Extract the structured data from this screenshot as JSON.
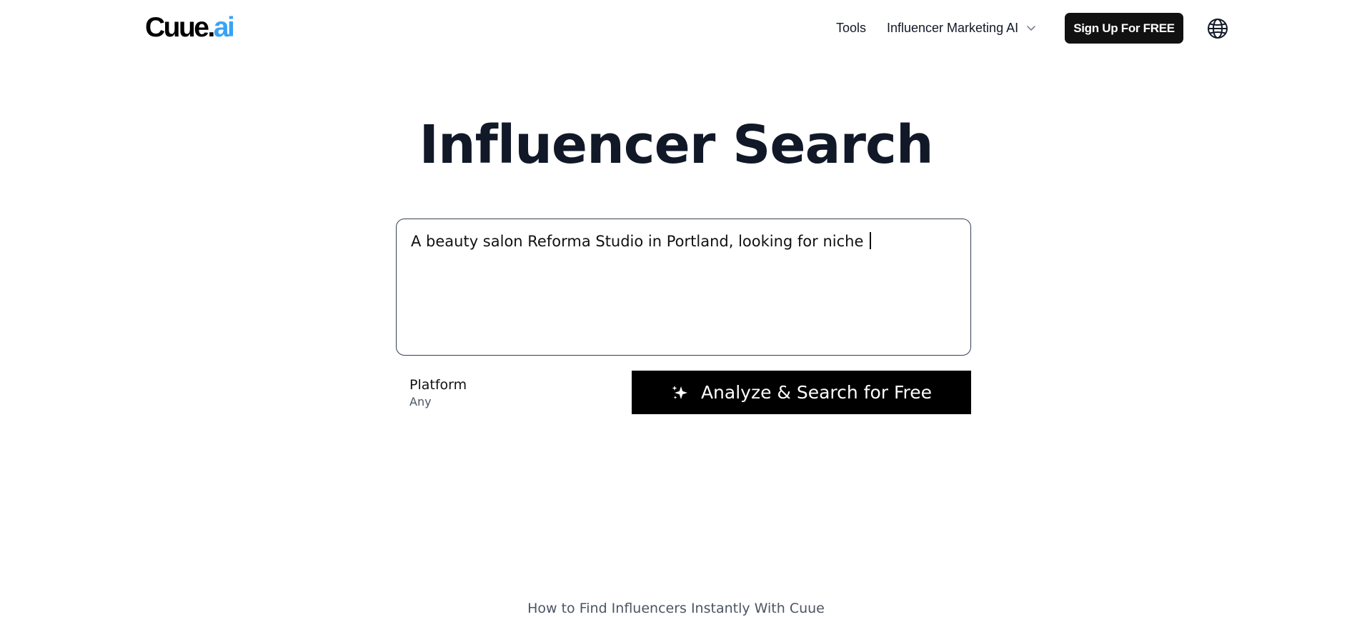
{
  "header": {
    "logo_main": "Cuue.",
    "logo_accent": "ai",
    "nav": {
      "tools": "Tools",
      "marketing_ai": "Influencer Marketing AI"
    },
    "signup_label": "Sign Up For FREE",
    "language_icon": "globe-icon"
  },
  "main": {
    "title": "Influencer Search",
    "query": {
      "value": "A beauty salon Reforma Studio in Portland, looking for niche "
    },
    "platform": {
      "label": "Platform",
      "value": "Any"
    },
    "analyze_button": {
      "label": "Analyze & Search for Free",
      "icon": "sparkle-icon"
    }
  },
  "footer": {
    "howto": "How to Find Influencers Instantly With Cuue"
  },
  "colors": {
    "logo_accent": "#38a3f5",
    "primary_button": "#000000",
    "signup_button": "#111111",
    "title_text": "#111827",
    "muted_text": "#4b5563"
  }
}
